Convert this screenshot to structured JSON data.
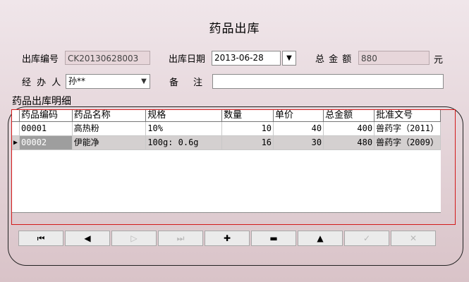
{
  "form": {
    "title": "药品出库",
    "outbound_no_label": "出库编号",
    "outbound_no_value": "CK20130628003",
    "outbound_date_label": "出库日期",
    "outbound_date_value": "2013-06-28",
    "total_label": "总 金 额",
    "total_value": "880",
    "total_unit": "元",
    "handler_label": "经 办 人",
    "handler_value": "孙**",
    "remark_label": "备　注",
    "remark_value": "",
    "details_label": "药品出库明细"
  },
  "table": {
    "columns": [
      "药品编码",
      "药品名称",
      "规格",
      "数量",
      "单价",
      "总金额",
      "批准文号"
    ],
    "rows": [
      {
        "code": "00001",
        "name": "高热粉",
        "spec": "10%",
        "qty": "10",
        "price": "40",
        "amount": "400",
        "approval": "兽药字（2011）"
      },
      {
        "code": "00002",
        "name": "伊能净",
        "spec": "100g: 0.6g",
        "qty": "16",
        "price": "30",
        "amount": "480",
        "approval": "兽药字（2009）"
      }
    ],
    "selected_row": 1
  },
  "navigator": {
    "buttons": [
      {
        "name": "first-record-button",
        "icon": "first-icon",
        "glyph": "⏮",
        "enabled": true
      },
      {
        "name": "prior-record-button",
        "icon": "prior-icon",
        "glyph": "◀",
        "enabled": true
      },
      {
        "name": "next-record-button",
        "icon": "next-icon",
        "glyph": "▷",
        "enabled": false
      },
      {
        "name": "last-record-button",
        "icon": "last-icon",
        "glyph": "⏭",
        "enabled": false
      },
      {
        "name": "insert-record-button",
        "icon": "plus-icon",
        "glyph": "✚",
        "enabled": true
      },
      {
        "name": "delete-record-button",
        "icon": "minus-icon",
        "glyph": "▬",
        "enabled": true
      },
      {
        "name": "edit-record-button",
        "icon": "up-triangle-icon",
        "glyph": "▲",
        "enabled": true
      },
      {
        "name": "post-record-button",
        "icon": "check-icon",
        "glyph": "✓",
        "enabled": false
      },
      {
        "name": "cancel-record-button",
        "icon": "x-icon",
        "glyph": "✕",
        "enabled": false
      }
    ]
  },
  "colors": {
    "accent_red": "#d21a1a",
    "selection": "#9e9e9e"
  }
}
